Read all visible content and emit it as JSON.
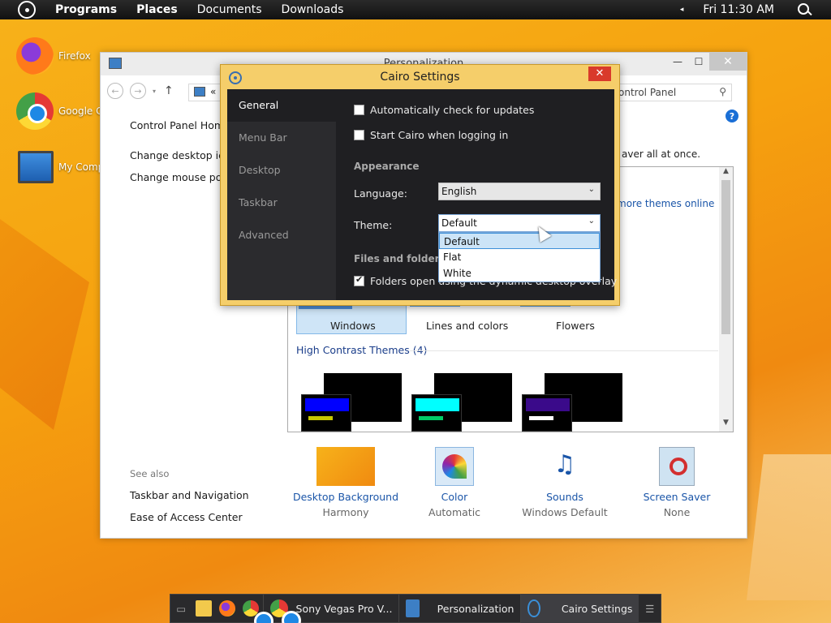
{
  "menubar": {
    "items": [
      "Programs",
      "Places",
      "Documents",
      "Downloads"
    ],
    "clock": "Fri 11:30 AM",
    "tray_arrow": "◂"
  },
  "desktop": {
    "icons": [
      {
        "label": "Firefox",
        "icon": "firefox-icon"
      },
      {
        "label": "Google C",
        "icon": "chrome-icon"
      },
      {
        "label": "My Comp",
        "icon": "computer-icon"
      }
    ]
  },
  "personalization": {
    "title": "Personalization",
    "search_text": "ontrol Panel",
    "address_text": "«",
    "leftnav": {
      "home": "Control Panel Home",
      "links": [
        "Change desktop icon",
        "Change mouse point"
      ],
      "see_also_title": "See also",
      "see_also": [
        "Taskbar and Navigation",
        "Ease of Access Center"
      ]
    },
    "hint": "aver all at once.",
    "more_themes": "more themes online",
    "themes": [
      {
        "name": "Windows"
      },
      {
        "name": "Lines and colors"
      },
      {
        "name": "Flowers"
      }
    ],
    "high_contrast_title": "High Contrast Themes (4)",
    "high_contrast": [
      {
        "bar_color": "#0000ff",
        "accent_color": "#c8c800"
      },
      {
        "bar_color": "#00ffff",
        "accent_color": "#00cc66"
      },
      {
        "bar_color": "#3a0a8a",
        "accent_color": "#ffffff"
      }
    ],
    "bottom": [
      {
        "name": "Desktop Background",
        "sub": "Harmony",
        "icon": "desktop-background-icon"
      },
      {
        "name": "Color",
        "sub": "Automatic",
        "icon": "color-icon"
      },
      {
        "name": "Sounds",
        "sub": "Windows Default",
        "icon": "sounds-icon"
      },
      {
        "name": "Screen Saver",
        "sub": "None",
        "icon": "screen-saver-icon"
      }
    ]
  },
  "cairo": {
    "title": "Cairo Settings",
    "close": "✕",
    "sidebar": [
      "General",
      "Menu Bar",
      "Desktop",
      "Taskbar",
      "Advanced"
    ],
    "check_updates": "Automatically check for updates",
    "start_login": "Start Cairo when logging in",
    "appearance_title": "Appearance",
    "language_label": "Language:",
    "language_value": "English",
    "theme_label": "Theme:",
    "theme_value": "Default",
    "theme_options": [
      "Default",
      "Flat",
      "White"
    ],
    "files_title": "Files and folders",
    "folders_dynamic": "Folders open using the dynamic desktop overlay"
  },
  "taskbar": {
    "tasks": [
      {
        "label": "Sony Vegas Pro V...",
        "icon": "chrome-icon"
      },
      {
        "label": "Personalization",
        "icon": "control-panel-icon"
      },
      {
        "label": "Cairo Settings",
        "icon": "cairo-icon"
      }
    ]
  }
}
